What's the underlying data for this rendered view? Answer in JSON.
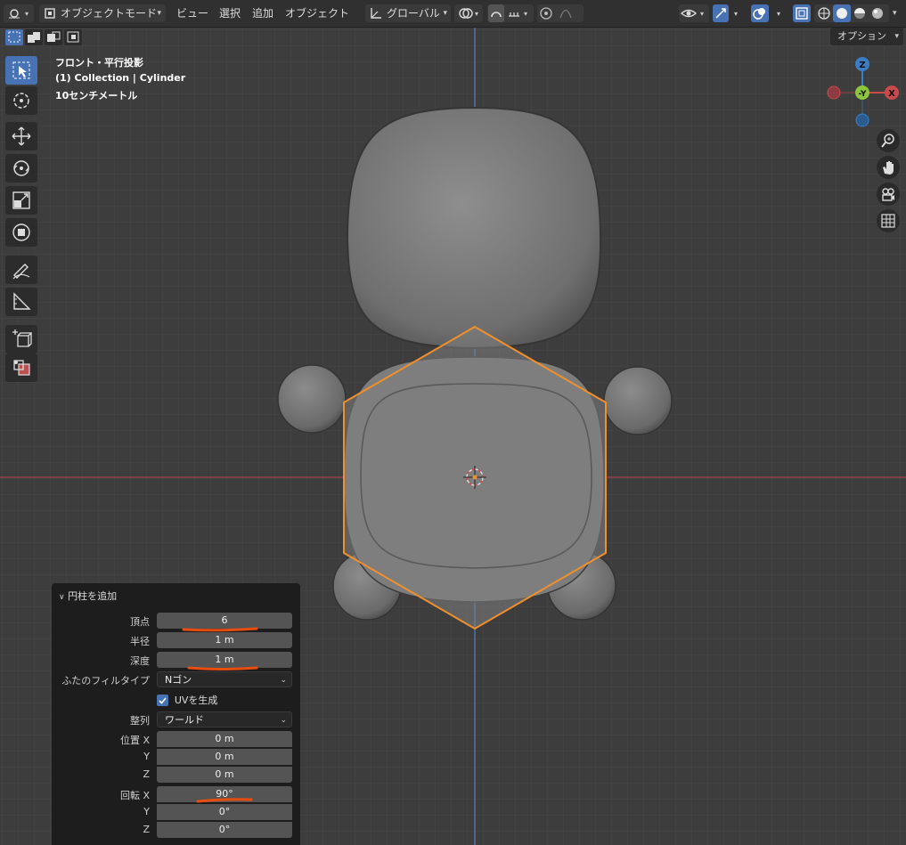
{
  "header": {
    "mode_label": "オブジェクトモード",
    "menu": [
      "ビュー",
      "選択",
      "追加",
      "オブジェクト"
    ],
    "transform_orientation": "グローバル",
    "options_label": "オプション"
  },
  "overlay": {
    "view_name": "フロント・平行投影",
    "collection": "(1) Collection | Cylinder",
    "scale": "10センチメートル"
  },
  "gizmo": {
    "z": "Z",
    "neg_y": "-Y",
    "x": "X"
  },
  "panel": {
    "title": "円柱を追加",
    "vertices_label": "頂点",
    "vertices_value": "6",
    "radius_label": "半径",
    "radius_value": "1 m",
    "depth_label": "深度",
    "depth_value": "1 m",
    "cap_fill_label": "ふたのフィルタイプ",
    "cap_fill_value": "Nゴン",
    "generate_uvs_label": "UVを生成",
    "generate_uvs_checked": true,
    "align_label": "整列",
    "align_value": "ワールド",
    "location_label": "位置 X",
    "location_y_label": "Y",
    "location_z_label": "Z",
    "location_x": "0 m",
    "location_y": "0 m",
    "location_z": "0 m",
    "rotation_label": "回転 X",
    "rotation_y_label": "Y",
    "rotation_z_label": "Z",
    "rotation_x": "90°",
    "rotation_y": "0°",
    "rotation_z": "0°"
  },
  "colors": {
    "accent": "#4772b3",
    "selection_outline": "#f0902d",
    "axis_x": "#c84a4a",
    "axis_z": "#3b7ec6",
    "annotation": "#e84d10"
  }
}
